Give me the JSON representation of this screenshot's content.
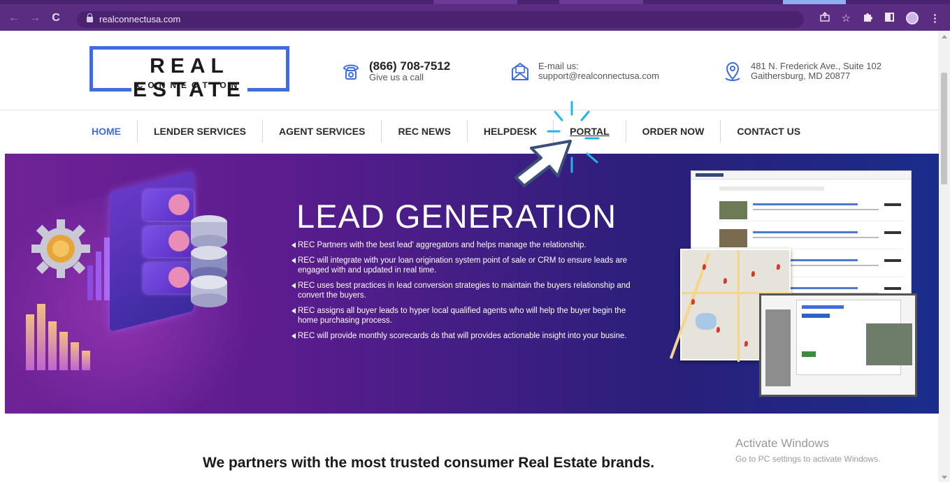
{
  "browser": {
    "url": "realconnectusa.com",
    "nav": {
      "back": "←",
      "forward": "→",
      "reload": "C"
    },
    "icons": [
      "share-icon",
      "star-icon",
      "extensions-icon",
      "sidepanel-icon",
      "profile-avatar",
      "menu-icon"
    ],
    "colors": {
      "frame": "#5a2d82"
    }
  },
  "header": {
    "logo": {
      "word": "REAL ESTATE",
      "sub": "CONNECTION",
      "color": "#3d6de0"
    },
    "phone": {
      "number": "(866) 708-7512",
      "caption": "Give us a call"
    },
    "email": {
      "label": "E-mail us:",
      "address": "support@realconnectusa.com"
    },
    "address": {
      "line1": "481 N. Frederick Ave., Suite 102",
      "line2": "Gaithersburg, MD 20877"
    }
  },
  "nav": {
    "items": [
      {
        "label": "HOME"
      },
      {
        "label": "LENDER SERVICES"
      },
      {
        "label": "AGENT SERVICES"
      },
      {
        "label": "REC NEWS"
      },
      {
        "label": "HELPDESK"
      },
      {
        "label": "PORTAL"
      },
      {
        "label": "ORDER NOW"
      },
      {
        "label": "CONTACT US"
      }
    ],
    "active": "HOME",
    "accent": "#3d6de0"
  },
  "hero": {
    "title": "LEAD GENERATION",
    "bullets": [
      "REC Partners with the best lead' aggregators and helps manage the relationship.",
      "REC will integrate with your loan origination system point of sale or CRM to ensure leads are engaged with and updated in real time.",
      "REC uses best practices in lead conversion strategies to maintain the buyers relationship and convert the buyers.",
      "REC assigns all buyer leads to hyper local qualified agents who will help the buyer begin the home purchasing process.",
      "REC will provide monthly scorecards ds that will provides actionable insight into your busine."
    ]
  },
  "partners": {
    "heading": "We partners with the most trusted consumer Real Estate brands."
  },
  "watermark": {
    "line1": "Activate Windows",
    "line2": "Go to PC settings to activate Windows."
  }
}
